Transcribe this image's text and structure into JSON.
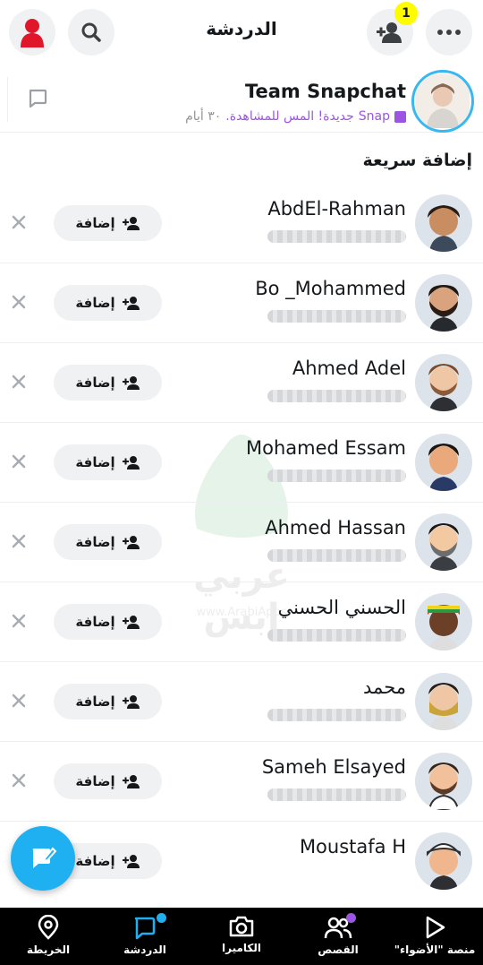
{
  "header": {
    "title": "الدردشة",
    "friend_request_count": "1",
    "icons": [
      "avatar-icon",
      "search-icon",
      "add-friend-icon",
      "more-icon"
    ]
  },
  "team": {
    "name": "Team Snapchat",
    "snap_label": "Snap",
    "status": "جديدة! المس للمشاهدة.",
    "age": "٣٠ أيام"
  },
  "quick_add": {
    "title": "إضافة سريعة",
    "add_label": "إضافة",
    "items": [
      {
        "name": "AbdEl-Rahman"
      },
      {
        "name": "Bo _Mohammed"
      },
      {
        "name": "Ahmed Adel"
      },
      {
        "name": "Mohamed Essam"
      },
      {
        "name": "Ahmed Hassan"
      },
      {
        "name": "الحسني الحسني"
      },
      {
        "name": "محمد"
      },
      {
        "name": "Sameh Elsayed"
      },
      {
        "name": "Moustafa H"
      }
    ]
  },
  "watermark": {
    "text": "عربي ابس",
    "sub": "www.ArabiApps"
  },
  "nav": {
    "items": [
      {
        "label": "الخريطة",
        "icon": "map-pin-icon"
      },
      {
        "label": "الدردشة",
        "icon": "chat-icon"
      },
      {
        "label": "الكاميرا",
        "icon": "camera-icon"
      },
      {
        "label": "القصص",
        "icon": "stories-icon"
      },
      {
        "label": "منصة \"الأضواء\"",
        "icon": "spotlight-icon"
      }
    ]
  },
  "colors": {
    "accent_blue": "#1fb0f2",
    "snap_purple": "#9b55e0",
    "badge_yellow": "#fffc00",
    "nav_bg": "#000000"
  }
}
